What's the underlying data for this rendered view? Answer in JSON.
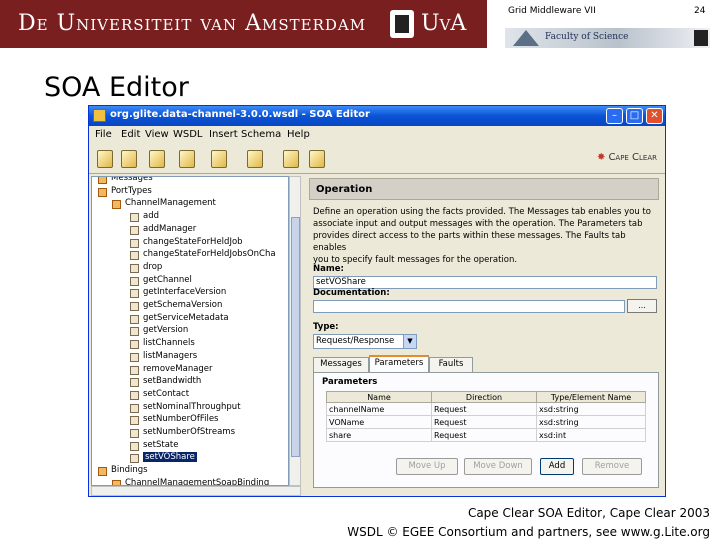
{
  "header": {
    "university": "De Universiteit van Amsterdam",
    "university_abbr": "UvA",
    "course": "Grid Middleware VII",
    "page_number": "24",
    "faculty": "Faculty of Science"
  },
  "slide_title": "SOA Editor",
  "window": {
    "title": "org.glite.data-channel-3.0.0.wsdl - SOA Editor",
    "menu": [
      "File",
      "Edit",
      "View",
      "WSDL",
      "Insert",
      "Schema",
      "Help"
    ],
    "brand": "Cape Clear"
  },
  "tree": {
    "items": [
      {
        "label": "Messages",
        "indent": 1,
        "type": "folder"
      },
      {
        "label": "PortTypes",
        "indent": 1,
        "type": "folder"
      },
      {
        "label": "ChannelManagement",
        "indent": 2,
        "type": "folder"
      },
      {
        "label": "add",
        "indent": 3,
        "type": "op"
      },
      {
        "label": "addManager",
        "indent": 3,
        "type": "op"
      },
      {
        "label": "changeStateForHeldJob",
        "indent": 3,
        "type": "op"
      },
      {
        "label": "changeStateForHeldJobsOnCha",
        "indent": 3,
        "type": "op"
      },
      {
        "label": "drop",
        "indent": 3,
        "type": "op"
      },
      {
        "label": "getChannel",
        "indent": 3,
        "type": "op"
      },
      {
        "label": "getInterfaceVersion",
        "indent": 3,
        "type": "op"
      },
      {
        "label": "getSchemaVersion",
        "indent": 3,
        "type": "op"
      },
      {
        "label": "getServiceMetadata",
        "indent": 3,
        "type": "op"
      },
      {
        "label": "getVersion",
        "indent": 3,
        "type": "op"
      },
      {
        "label": "listChannels",
        "indent": 3,
        "type": "op"
      },
      {
        "label": "listManagers",
        "indent": 3,
        "type": "op"
      },
      {
        "label": "removeManager",
        "indent": 3,
        "type": "op"
      },
      {
        "label": "setBandwidth",
        "indent": 3,
        "type": "op"
      },
      {
        "label": "setContact",
        "indent": 3,
        "type": "op"
      },
      {
        "label": "setNominalThroughput",
        "indent": 3,
        "type": "op"
      },
      {
        "label": "setNumberOfFiles",
        "indent": 3,
        "type": "op"
      },
      {
        "label": "setNumberOfStreams",
        "indent": 3,
        "type": "op"
      },
      {
        "label": "setState",
        "indent": 3,
        "type": "op"
      },
      {
        "label": "setVOShare",
        "indent": 3,
        "type": "op",
        "selected": true
      },
      {
        "label": "Bindings",
        "indent": 1,
        "type": "folder"
      },
      {
        "label": "ChannelManagementSoapBinding",
        "indent": 2,
        "type": "folder"
      }
    ]
  },
  "panel": {
    "header": "Operation",
    "description_lines": [
      "Define an operation using the facts provided. The Messages tab enables you to",
      "associate input and output messages with the operation. The Parameters tab",
      "provides direct access to the parts within these messages. The Faults tab enables",
      "you to specify fault messages for the operation."
    ],
    "name_label": "Name:",
    "name_value": "setVOShare",
    "documentation_label": "Documentation:",
    "documentation_value": "",
    "browse_button": "...",
    "type_label": "Type:",
    "type_value": "Request/Response",
    "tabs": [
      "Messages",
      "Parameters",
      "Faults"
    ],
    "parameters_label": "Parameters",
    "param_columns": [
      "Name",
      "Direction",
      "Type/Element Name"
    ],
    "param_rows": [
      [
        "channelName",
        "Request",
        "xsd:string"
      ],
      [
        "VOName",
        "Request",
        "xsd:string"
      ],
      [
        "share",
        "Request",
        "xsd:int"
      ]
    ],
    "buttons": [
      "Move Up",
      "Move Down",
      "Add",
      "Remove"
    ]
  },
  "caption": {
    "line1": "Cape Clear SOA Editor, Cape Clear  2003",
    "line2": "WSDL © EGEE Consortium and partners, see www.g.Lite.org"
  }
}
